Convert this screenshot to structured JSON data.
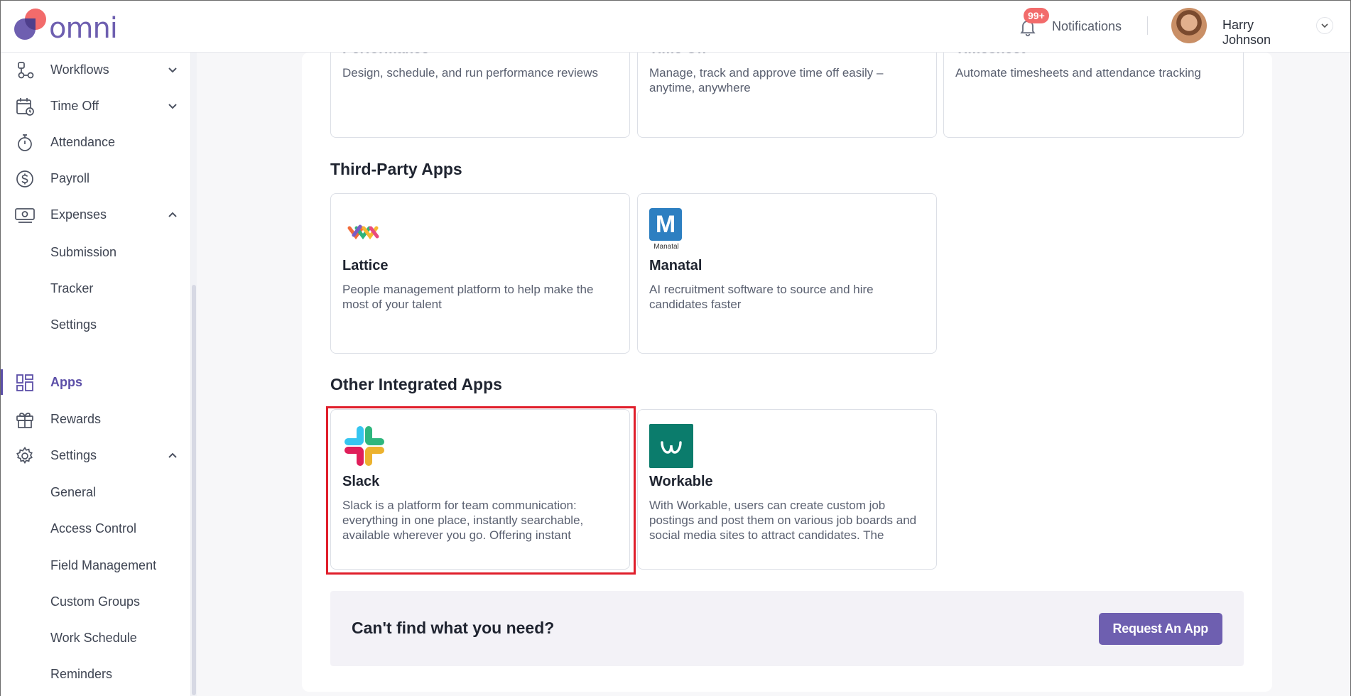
{
  "brand": {
    "name": "omni"
  },
  "header": {
    "notifications_badge": "99+",
    "notifications_label": "Notifications",
    "user_name": "Harry Johnson"
  },
  "sidebar": {
    "items": [
      {
        "label": "Workflows",
        "icon": "workflow-icon",
        "chevron": "down"
      },
      {
        "label": "Time Off",
        "icon": "calendar-clock-icon",
        "chevron": "down"
      },
      {
        "label": "Attendance",
        "icon": "stopwatch-icon"
      },
      {
        "label": "Payroll",
        "icon": "dollar-icon"
      },
      {
        "label": "Expenses",
        "icon": "cash-icon",
        "chevron": "up"
      },
      {
        "label": "Apps",
        "icon": "apps-grid-icon",
        "active": true
      },
      {
        "label": "Rewards",
        "icon": "gift-icon"
      },
      {
        "label": "Settings",
        "icon": "gear-icon",
        "chevron": "up"
      }
    ],
    "expenses_sub": [
      "Submission",
      "Tracker",
      "Settings"
    ],
    "settings_sub": [
      "General",
      "Access Control",
      "Field Management",
      "Custom Groups",
      "Work Schedule",
      "Reminders"
    ]
  },
  "top_cards": [
    {
      "title": "Performance",
      "desc": "Design, schedule, and run performance reviews"
    },
    {
      "title": "Time Off",
      "desc": "Manage, track and approve time off easily – anytime, anywhere"
    },
    {
      "title": "Timesheet",
      "desc": "Automate timesheets and attendance tracking"
    }
  ],
  "sections": {
    "third_party": "Third-Party Apps",
    "other_integrated": "Other Integrated Apps"
  },
  "third_party_apps": [
    {
      "title": "Lattice",
      "desc": "People management platform to help make the most of your talent"
    },
    {
      "title": "Manatal",
      "desc": "AI recruitment software to source and hire candidates faster",
      "logo_text": "Manatal",
      "logo_letter": "M"
    }
  ],
  "other_apps": [
    {
      "title": "Slack",
      "desc": "Slack is a platform for team communication: everything in one place, instantly searchable, available wherever you go. Offering instant"
    },
    {
      "title": "Workable",
      "desc": "With Workable, users can create custom job postings and post them on various job boards and social media sites to attract candidates. The"
    }
  ],
  "cta": {
    "question": "Can't find what you need?",
    "button": "Request An App"
  },
  "colors": {
    "accent": "#6e5fb0",
    "brand_red": "#f26b6b",
    "highlight": "#e01e2b"
  }
}
